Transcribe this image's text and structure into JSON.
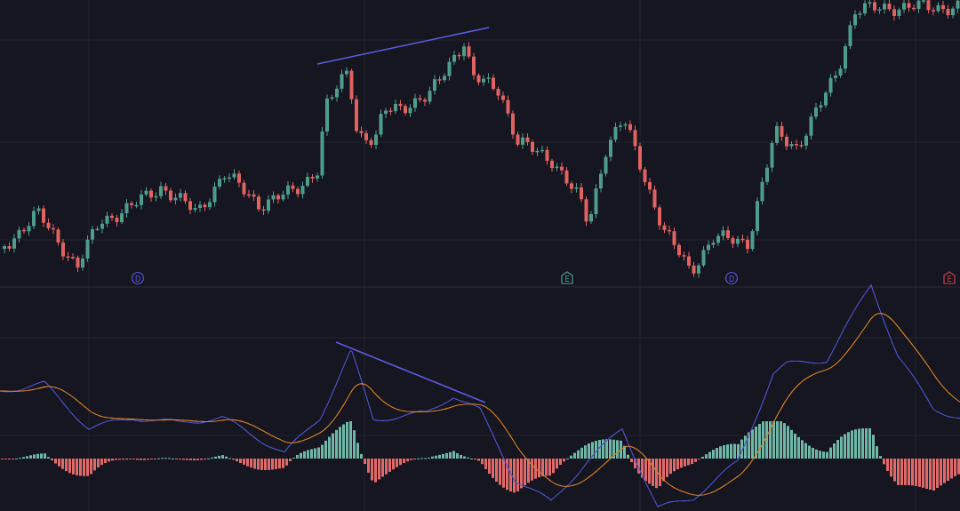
{
  "chart": {
    "markers": [
      {
        "kind": "dividend",
        "label": "D",
        "color": "#5656d8"
      },
      {
        "kind": "earnings",
        "label": "E",
        "color": "#4f9a8c"
      },
      {
        "kind": "dividend",
        "label": "D",
        "color": "#5656d8"
      },
      {
        "kind": "earnings",
        "label": "E",
        "color": "#c2404a"
      }
    ]
  }
}
